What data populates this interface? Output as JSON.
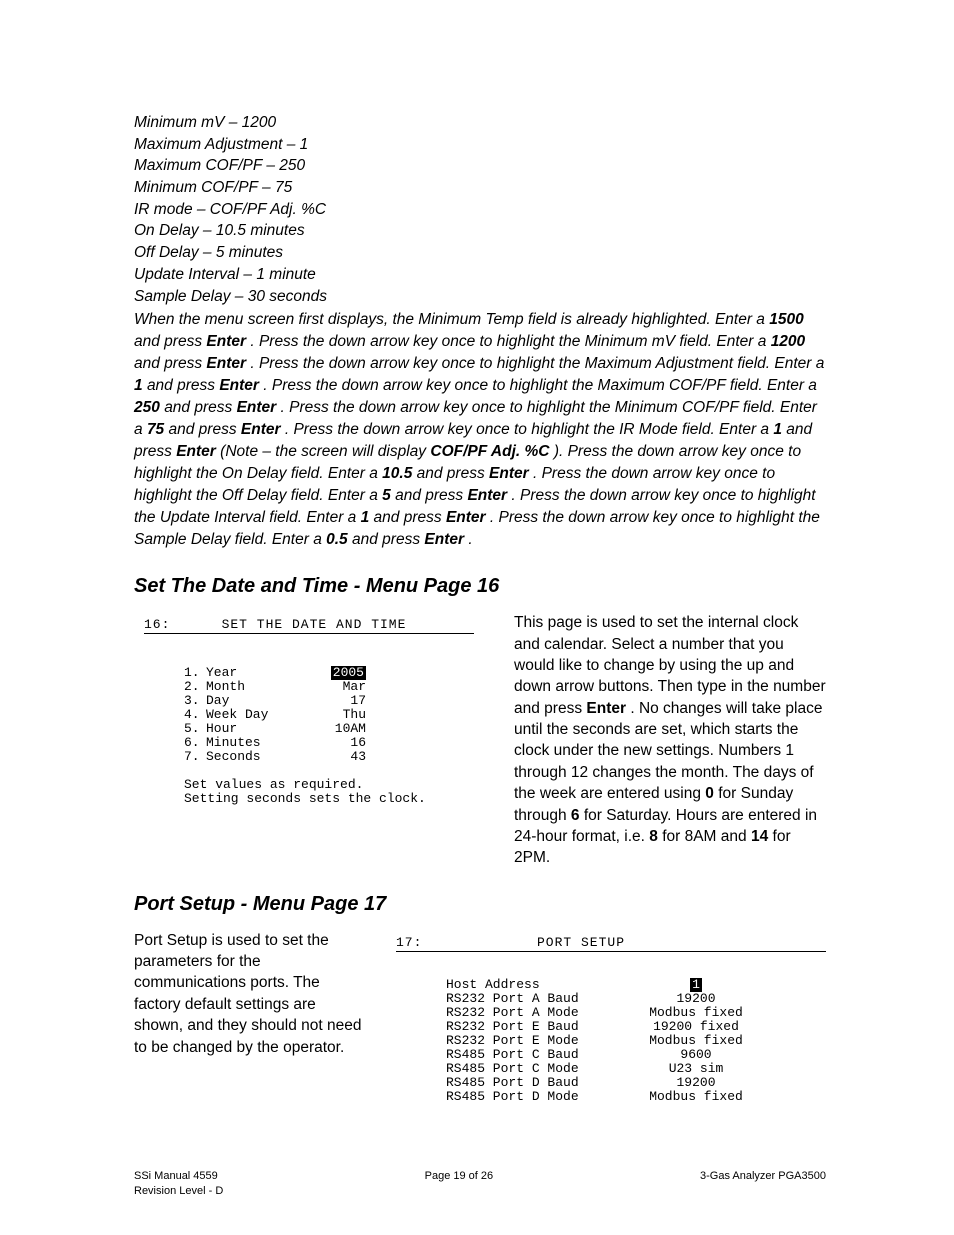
{
  "intro_lines": [
    "Minimum mV – 1200",
    "Maximum Adjustment – 1",
    "Maximum COF/PF – 250",
    "Minimum COF/PF – 75",
    "IR mode – COF/PF Adj. %C",
    "On Delay – 10.5 minutes",
    "Off Delay – 5 minutes",
    "Update Interval – 1 minute",
    "Sample Delay – 30 seconds"
  ],
  "para": {
    "t0": "When the menu screen first displays, the Minimum Temp field is already highlighted. Enter a ",
    "v1": "1500",
    "t1": " and press ",
    "e1": "Enter",
    "t2": ". Press the down arrow key once to highlight the Minimum mV field. Enter a ",
    "v2": "1200",
    "t3": " and press ",
    "e2": "Enter",
    "t4": ". Press the down arrow key once to highlight the Maximum Adjustment field. Enter a ",
    "v3": "1",
    "t5": " and press ",
    "e3": "Enter",
    "t6": ". Press the down arrow key once to highlight the Maximum COF/PF field. Enter a ",
    "v4": "250",
    "t7": " and press ",
    "e4": "Enter",
    "t8": ". Press the down arrow key once to highlight the Minimum COF/PF field. Enter a ",
    "v5": "75",
    "t9": " and press ",
    "e5": "Enter",
    "t10": ". Press the down arrow key once to highlight the IR Mode field. Enter a ",
    "v6": "1",
    "t11": " and press ",
    "e6": "Enter",
    "t12": " (Note – the screen will display ",
    "v7": "COF/PF Adj. %C",
    "t13": "). Press the down arrow key once to highlight the On Delay field. Enter a ",
    "v8": "10.5",
    "t14": " and press ",
    "e7": "Enter",
    "t15": ". Press the down arrow key once to highlight the Off Delay field. Enter a ",
    "v9": "5",
    "t16": " and press ",
    "e8": "Enter",
    "t17": ". Press the down arrow key once to highlight the Update Interval field. Enter a ",
    "v10": "1",
    "t18": " and press ",
    "e9": "Enter",
    "t19": ". Press the down arrow key once to highlight the Sample Delay field. Enter a ",
    "v11": "0.5",
    "t20": " and press ",
    "e10": "Enter",
    "t21": "."
  },
  "section1_title": "Set The Date and Time - Menu Page 16",
  "screen1": {
    "num": "16:",
    "title": "SET THE DATE AND TIME",
    "rows": [
      {
        "n": "1.",
        "l": "Year",
        "v": "2005",
        "hl": true
      },
      {
        "n": "2.",
        "l": "Month",
        "v": "Mar"
      },
      {
        "n": "3.",
        "l": "Day",
        "v": "17"
      },
      {
        "n": "4.",
        "l": "Week Day",
        "v": "Thu"
      },
      {
        "n": "5.",
        "l": "Hour",
        "v": "10AM"
      },
      {
        "n": "6.",
        "l": "Minutes",
        "v": "16"
      },
      {
        "n": "7.",
        "l": "Seconds",
        "v": "43"
      }
    ],
    "foot1": "Set values as required.",
    "foot2": "Setting seconds sets the clock."
  },
  "side1": {
    "t0": "This page is used to set the internal clock and calendar. Select a number that you would like to change by using the up and down arrow buttons.  Then type in the number and press ",
    "b1": "Enter",
    "t1": ".  No changes will take place until the seconds are set, which starts the clock under the new settings.  Numbers 1 through 12 changes the month.  The days of the week are entered using ",
    "b2": "0",
    "t2": " for Sunday through ",
    "b3": "6",
    "t3": " for Saturday.  Hours are entered in 24-hour format, i.e. ",
    "b4": "8",
    "t4": " for 8AM and ",
    "b5": "14",
    "t5": " for 2PM."
  },
  "section2_title": "Port Setup - Menu Page 17",
  "side2": "Port Setup is used to set the parameters for the communications ports.  The factory default settings are shown, and they should not need to be changed by the operator.",
  "screen2": {
    "num": "17:",
    "title": "PORT SETUP",
    "rows": [
      {
        "l": "Host Address",
        "v": "1",
        "hl": true
      },
      {
        "l": "RS232 Port A Baud",
        "v": "19200"
      },
      {
        "l": "RS232 Port A Mode",
        "v": "Modbus fixed"
      },
      {
        "l": "RS232 Port E Baud",
        "v": "19200 fixed"
      },
      {
        "l": "RS232 Port E Mode",
        "v": "Modbus fixed"
      },
      {
        "l": "RS485 Port C Baud",
        "v": "9600"
      },
      {
        "l": "RS485 Port C Mode",
        "v": "U23 sim"
      },
      {
        "l": "RS485 Port D Baud",
        "v": "19200"
      },
      {
        "l": "RS485 Port D Mode",
        "v": "Modbus fixed"
      }
    ]
  },
  "footer": {
    "left1": "SSi Manual 4559",
    "center": "Page 19 of 26",
    "right": "3-Gas Analyzer PGA3500",
    "left2": "Revision Level - D"
  }
}
